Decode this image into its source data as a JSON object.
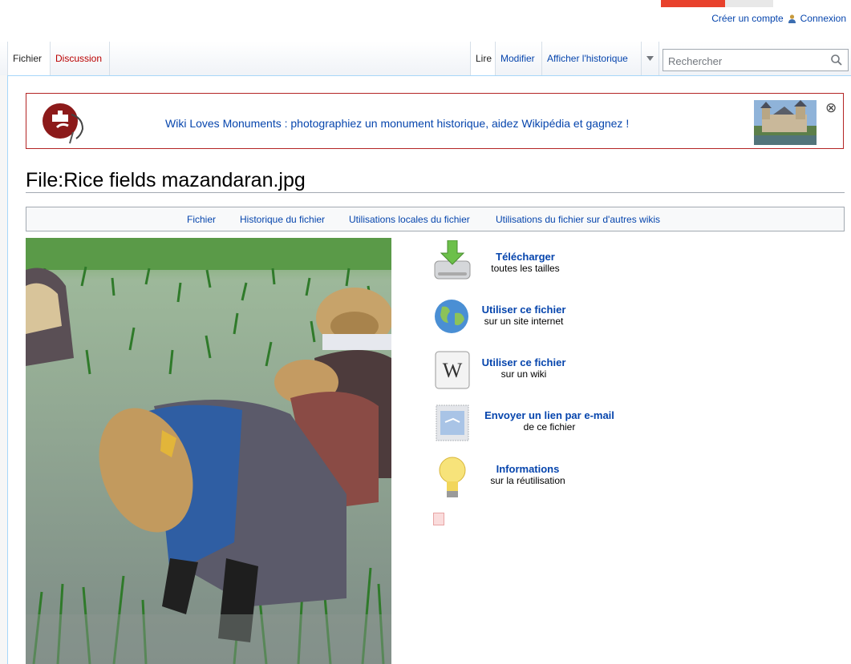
{
  "personal": {
    "create_account": "Créer un compte",
    "login": "Connexion"
  },
  "tabs": {
    "file": "Fichier",
    "discussion": "Discussion",
    "read": "Lire",
    "edit": "Modifier",
    "history": "Afficher l'historique"
  },
  "search": {
    "placeholder": "Rechercher"
  },
  "banner": {
    "text": "Wiki Loves Monuments : photographiez un monument historique, aidez Wikipédia et gagnez !"
  },
  "page": {
    "title": "File:Rice fields mazandaran.jpg"
  },
  "filetoc": {
    "file": "Fichier",
    "history": "Historique du fichier",
    "local_uses": "Utilisations locales du fichier",
    "global_uses": "Utilisations du fichier sur d'autres wikis"
  },
  "actions": {
    "download": {
      "title": "Télécharger",
      "sub": "toutes les tailles"
    },
    "use_web": {
      "title": "Utiliser ce fichier",
      "sub": "sur un site internet"
    },
    "use_wiki": {
      "title": "Utiliser ce fichier",
      "sub": "sur un wiki"
    },
    "email": {
      "title": "Envoyer un lien par e-mail",
      "sub": "de ce fichier"
    },
    "info": {
      "title": "Informations",
      "sub": "sur la réutilisation"
    }
  }
}
